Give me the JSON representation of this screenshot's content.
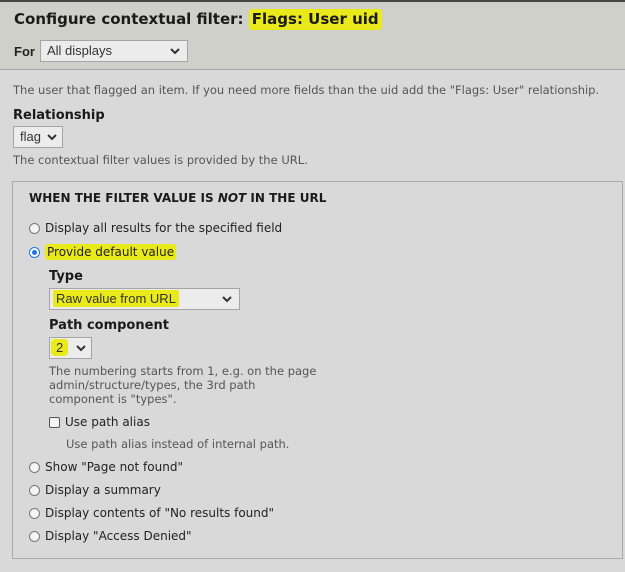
{
  "header": {
    "title_prefix": "Configure contextual filter: ",
    "title_highlight": "Flags: User uid",
    "for_label": "For",
    "for_select_value": "All displays"
  },
  "description": "The user that flagged an item. If you need more fields than the uid add the \"Flags: User\" relationship.",
  "relationship": {
    "label": "Relationship",
    "select_value": "flag",
    "help": "The contextual filter values is provided by the URL."
  },
  "fieldset": {
    "legend_before": "WHEN THE FILTER VALUE IS ",
    "legend_emph": "NOT",
    "legend_after": " IN THE URL",
    "options": [
      {
        "label": "Display all results for the specified field",
        "checked": false
      },
      {
        "label": "Provide default value",
        "checked": true
      },
      {
        "label": "Show \"Page not found\"",
        "checked": false
      },
      {
        "label": "Display a summary",
        "checked": false
      },
      {
        "label": "Display contents of \"No results found\"",
        "checked": false
      },
      {
        "label": "Display \"Access Denied\"",
        "checked": false
      }
    ],
    "type": {
      "label": "Type",
      "select_value": "Raw value from URL"
    },
    "path_component": {
      "label": "Path component",
      "select_value": "2",
      "help_line1": "The numbering starts from 1, e.g. on the page",
      "help_line2": "admin/structure/types, the 3rd path",
      "help_line3": "component is \"types\"."
    },
    "use_path_alias": {
      "label": "Use path alias",
      "checked": false,
      "help": "Use path alias instead of internal path."
    }
  },
  "colors": {
    "highlight": "#eaea1a",
    "radio_checked": "#1a73e8",
    "background": "#d9d9d9",
    "header_background": "#d0d0cb"
  }
}
